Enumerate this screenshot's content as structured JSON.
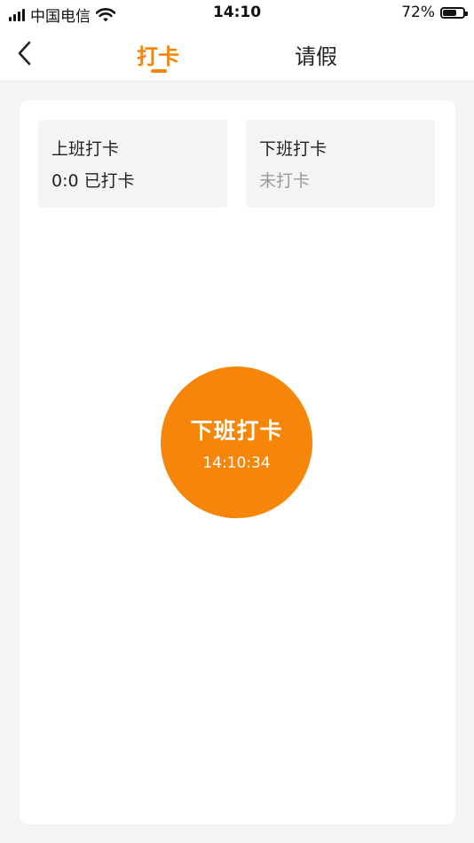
{
  "status_bar": {
    "carrier": "中国电信",
    "time": "14:10",
    "battery_percent": "72%",
    "battery_level": 0.72
  },
  "nav": {
    "back_icon": "chevron-left-icon",
    "tabs": [
      {
        "label": "打卡",
        "active": true
      },
      {
        "label": "请假",
        "active": false
      }
    ],
    "accent_color": "#f5840c"
  },
  "clock_in": {
    "title": "上班打卡",
    "status": "0:0 已打卡"
  },
  "clock_out": {
    "title": "下班打卡",
    "status": "未打卡"
  },
  "punch_button": {
    "label": "下班打卡",
    "time": "14:10:34",
    "color": "#f5860a"
  }
}
